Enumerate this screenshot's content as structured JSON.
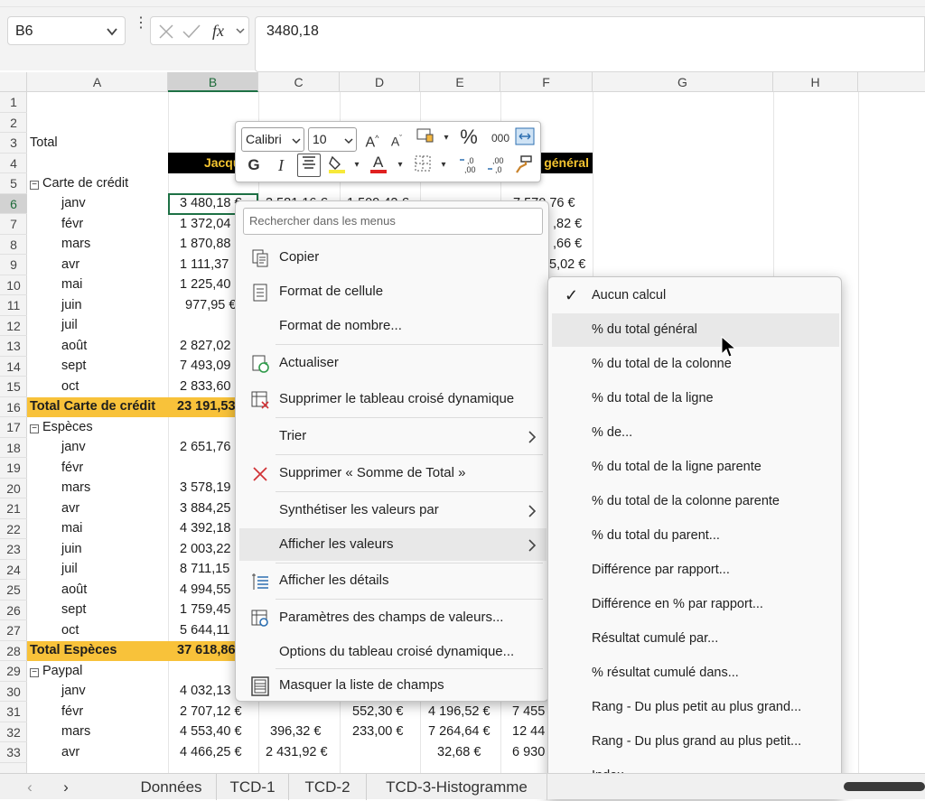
{
  "formula_bar": {
    "name_box": "B6",
    "value": "3480,18",
    "fx_label": "fx"
  },
  "columns": [
    "A",
    "B",
    "C",
    "D",
    "E",
    "F",
    "G",
    "H"
  ],
  "rows": [
    "1",
    "2",
    "3",
    "4",
    "5",
    "6",
    "7",
    "8",
    "9",
    "10",
    "11",
    "12",
    "13",
    "14",
    "15",
    "16",
    "17",
    "18",
    "19",
    "20",
    "21",
    "22",
    "23",
    "24",
    "25",
    "26",
    "27",
    "28",
    "29",
    "30",
    "31",
    "32",
    "33"
  ],
  "cells": {
    "a3": "Total",
    "b4": "Jacques",
    "f4": "général",
    "a5": "Carte de crédit",
    "a6": "janv",
    "b6": "3 480,18 €",
    "c6": "3 581,16 €",
    "d6": "1 509,42 €",
    "f6": "7 570,76 €",
    "a7": "févr",
    "b7": "1 372,04",
    "f7": ",82 €",
    "a8": "mars",
    "b8": "1 870,88",
    "f8": ",66 €",
    "a9": "avr",
    "b9": "1 111,37",
    "f9": "5,02 €",
    "a10": "mai",
    "b10": "1 225,40",
    "a11": "juin",
    "b11": "977,95 €",
    "a12": "juil",
    "a13": "août",
    "b13": "2 827,02",
    "a14": "sept",
    "b14": "7 493,09",
    "a15": "oct",
    "b15": "2 833,60",
    "a16": "Total Carte de crédit",
    "b16": "23 191,53",
    "a17": "Espèces",
    "a18": "janv",
    "b18": "2 651,76",
    "a19": "févr",
    "a20": "mars",
    "b20": "3 578,19",
    "a21": "avr",
    "b21": "3 884,25",
    "a22": "mai",
    "b22": "4 392,18",
    "a23": "juin",
    "b23": "2 003,22",
    "a24": "juil",
    "b24": "8 711,15",
    "a25": "août",
    "b25": "4 994,55",
    "a26": "sept",
    "b26": "1 759,45",
    "a27": "oct",
    "b27": "5 644,11",
    "a28": "Total Espèces",
    "b28": "37 618,86",
    "a29": "Paypal",
    "a30": "janv",
    "b30": "4 032,13",
    "a31": "févr",
    "b31": "2 707,12 €",
    "d31": "552,30 €",
    "e31": "4 196,52 €",
    "f31": "7 455",
    "a32": "mars",
    "b32": "4 553,40 €",
    "c32": "396,32 €",
    "d32": "233,00 €",
    "e32": "7 264,64 €",
    "f32": "12 44",
    "a33": "avr",
    "b33": "4 466,25 €",
    "c33": "2 431,92 €",
    "e33": "32,68 €",
    "f33": "6 930"
  },
  "mini_toolbar": {
    "font": "Calibri",
    "size": "10",
    "bold": "G",
    "italic": "I",
    "percent": "%",
    "thousands": "000"
  },
  "context_menu": {
    "search_placeholder": "Rechercher dans les menus",
    "items": [
      {
        "label": "Copier"
      },
      {
        "label": "Format de cellule"
      },
      {
        "label": "Format de nombre..."
      },
      {
        "label": "Actualiser"
      },
      {
        "label": "Supprimer le tableau croisé dynamique"
      },
      {
        "label": "Trier"
      },
      {
        "label": "Supprimer « Somme de Total »"
      },
      {
        "label": "Synthétiser les valeurs par"
      },
      {
        "label": "Afficher les valeurs"
      },
      {
        "label": "Afficher les détails"
      },
      {
        "label": "Paramètres des champs de valeurs..."
      },
      {
        "label": "Options du tableau croisé dynamique..."
      },
      {
        "label": "Masquer la liste de champs"
      }
    ]
  },
  "submenu": {
    "items": [
      {
        "label": "Aucun calcul",
        "checked": true
      },
      {
        "label": "% du total général"
      },
      {
        "label": "% du total de la colonne"
      },
      {
        "label": "% du total de la ligne"
      },
      {
        "label": "% de..."
      },
      {
        "label": "% du total de la ligne parente"
      },
      {
        "label": "% du total de la colonne parente"
      },
      {
        "label": "% du total du parent..."
      },
      {
        "label": "Différence par rapport..."
      },
      {
        "label": "Différence en % par rapport..."
      },
      {
        "label": "Résultat cumulé par..."
      },
      {
        "label": "% résultat cumulé dans..."
      },
      {
        "label": "Rang - Du plus petit au plus grand..."
      },
      {
        "label": "Rang - Du plus grand au plus petit..."
      },
      {
        "label": "Index"
      }
    ]
  },
  "sheet_tabs": [
    "Données",
    "TCD-1",
    "TCD-2",
    "TCD-3-Histogramme"
  ],
  "colors": {
    "total_row": "#f8c23a",
    "header_black": "#000000",
    "header_text": "#f4c430",
    "selection": "#1e7145"
  }
}
